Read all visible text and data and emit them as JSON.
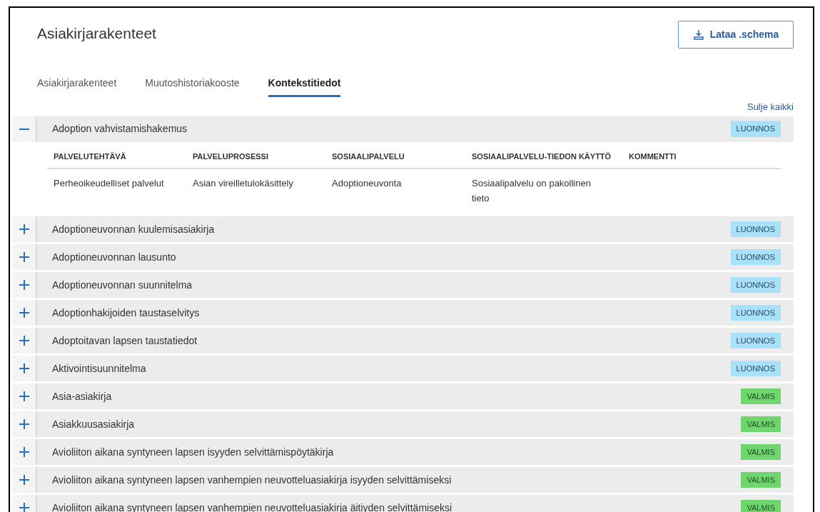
{
  "page": {
    "title": "Asiakirjarakenteet",
    "download_button": "Lataa .schema"
  },
  "tabs": [
    {
      "label": "Asiakirjarakenteet",
      "selected": false
    },
    {
      "label": "Muutoshistoriakooste",
      "selected": false
    },
    {
      "label": "Kontekstitiedot",
      "selected": true
    }
  ],
  "collapse_all_link": "Sulje kaikki",
  "documents": [
    {
      "title": "Adoption vahvistamishakemus",
      "expanded": true,
      "status": {
        "label": "LUONNOS",
        "kind": "draft"
      },
      "details": {
        "columns": [
          "PALVELUTEHTÄVÄ",
          "PALVELUPROSESSI",
          "SOSIAALIPALVELU",
          "SOSIAALIPALVELU-TIEDON KÄYTTÖ",
          "KOMMENTTI"
        ],
        "rows": [
          [
            "Perheoikeudelliset palvelut",
            "Asian vireilletulokäsittely",
            "Adoptioneuvonta",
            "Sosiaalipalvelu on pakollinen tieto",
            ""
          ]
        ]
      }
    },
    {
      "title": "Adoptioneuvonnan kuulemisasiakirja",
      "expanded": false,
      "status": {
        "label": "LUONNOS",
        "kind": "draft"
      }
    },
    {
      "title": "Adoptioneuvonnan lausunto",
      "expanded": false,
      "status": {
        "label": "LUONNOS",
        "kind": "draft"
      }
    },
    {
      "title": "Adoptioneuvonnan suunnitelma",
      "expanded": false,
      "status": {
        "label": "LUONNOS",
        "kind": "draft"
      }
    },
    {
      "title": "Adoptionhakijoiden taustaselvitys",
      "expanded": false,
      "status": {
        "label": "LUONNOS",
        "kind": "draft"
      }
    },
    {
      "title": "Adoptoitavan lapsen taustatiedot",
      "expanded": false,
      "status": {
        "label": "LUONNOS",
        "kind": "draft"
      }
    },
    {
      "title": "Aktivointisuunnitelma",
      "expanded": false,
      "status": {
        "label": "LUONNOS",
        "kind": "draft"
      }
    },
    {
      "title": "Asia-asiakirja",
      "expanded": false,
      "status": {
        "label": "VALMIS",
        "kind": "ready"
      }
    },
    {
      "title": "Asiakkuusasiakirja",
      "expanded": false,
      "status": {
        "label": "VALMIS",
        "kind": "ready"
      }
    },
    {
      "title": "Avioliiton aikana syntyneen lapsen isyyden selvittämispöytäkirja",
      "expanded": false,
      "status": {
        "label": "VALMIS",
        "kind": "ready"
      }
    },
    {
      "title": "Avioliiton aikana syntyneen lapsen vanhempien neuvotteluasiakirja isyyden selvittämiseksi",
      "expanded": false,
      "status": {
        "label": "VALMIS",
        "kind": "ready"
      }
    },
    {
      "title": "Avioliiton aikana syntyneen lapsen vanhempien neuvotteluasiakirja äitiyden selvittämiseksi",
      "expanded": false,
      "status": {
        "label": "VALMIS",
        "kind": "ready"
      }
    }
  ]
}
